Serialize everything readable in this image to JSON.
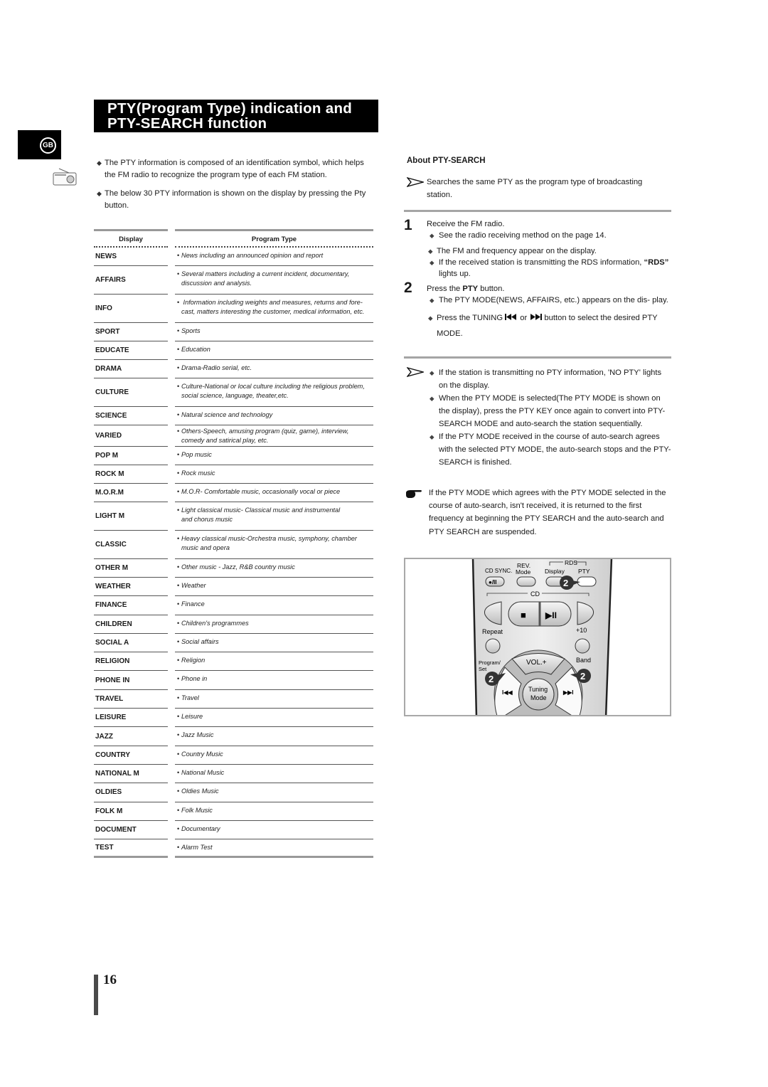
{
  "header": {
    "title_line1": "PTY(Program Type) indication and",
    "title_line2": "PTY-SEARCH function",
    "language_badge": "GB",
    "section_icon": "radio-icon"
  },
  "intro": [
    {
      "line1": "The PTY information is composed of an identification symbol, which helps",
      "line2": "the FM radio to recognize the program type of each FM station."
    },
    {
      "line1": "The below 30 PTY information is shown on the display by pressing the Pty",
      "line2": "button."
    }
  ],
  "bullet_diamond": "◆",
  "pty_table": {
    "headers": {
      "display": "Display",
      "program_type": "Program Type"
    },
    "rows": [
      {
        "display": "NEWS",
        "l1": "News including an announced opinion and report",
        "l2": ""
      },
      {
        "display": "AFFAIRS",
        "l1": "Several matters including a current incident, documentary,",
        "l2": "discussion and analysis."
      },
      {
        "display": "INFO",
        "l1": " Information including weights and measures, returns and fore-",
        "l2": "cast, matters interesting the customer, medical information, etc."
      },
      {
        "display": "SPORT",
        "l1": "Sports",
        "l2": ""
      },
      {
        "display": "EDUCATE",
        "l1": "Education",
        "l2": ""
      },
      {
        "display": "DRAMA",
        "l1": "Drama-Radio serial, etc.",
        "l2": ""
      },
      {
        "display": "CULTURE",
        "l1": "Culture-National or local culture including the religious problem,",
        "l2": "social science, language, theater,etc."
      },
      {
        "display": "SCIENCE",
        "l1": "Natural science and technology",
        "l2": ""
      },
      {
        "display": "VARIED",
        "l1": "Others-Speech, amusing program (quiz, game), interview,",
        "l2": "comedy and satirical play, etc."
      },
      {
        "display": "POP M",
        "l1": "Pop music",
        "l2": ""
      },
      {
        "display": "ROCK M",
        "l1": "Rock music",
        "l2": ""
      },
      {
        "display": "M.O.R.M",
        "l1": "M.O.R- Comfortable music, occasionally vocal or piece",
        "l2": ""
      },
      {
        "display": "LIGHT M",
        "l1": "Light classical music- Classical music and instrumental",
        "l2": "and chorus music"
      },
      {
        "display": "CLASSIC",
        "l1": "Heavy classical  music-Orchestra music, symphony, chamber",
        "l2": "music and opera"
      },
      {
        "display": "OTHER M",
        "l1": "Other music - Jazz, R&B country music",
        "l2": ""
      },
      {
        "display": "WEATHER",
        "l1": "Weather",
        "l2": ""
      },
      {
        "display": "FINANCE",
        "l1": "Finance",
        "l2": ""
      },
      {
        "display": "CHILDREN",
        "l1": "Children's programmes",
        "l2": ""
      },
      {
        "display": "SOCIAL  A",
        "l1": "Social affairs",
        "l2": ""
      },
      {
        "display": "RELIGION",
        "l1": "Religion",
        "l2": ""
      },
      {
        "display": "PHONE IN",
        "l1": "Phone in",
        "l2": ""
      },
      {
        "display": "TRAVEL",
        "l1": "Travel",
        "l2": ""
      },
      {
        "display": "LEISURE",
        "l1": "Leisure",
        "l2": ""
      },
      {
        "display": "JAZZ",
        "l1": "Jazz Music",
        "l2": ""
      },
      {
        "display": "COUNTRY",
        "l1": "Country Music",
        "l2": ""
      },
      {
        "display": "NATIONAL M",
        "l1": "National Music",
        "l2": ""
      },
      {
        "display": "OLDIES",
        "l1": "Oldies Music",
        "l2": ""
      },
      {
        "display": "FOLK M",
        "l1": "Folk Music",
        "l2": ""
      },
      {
        "display": "DOCUMENT",
        "l1": "Documentary",
        "l2": ""
      },
      {
        "display": "TEST",
        "l1": "Alarm Test",
        "l2": ""
      }
    ]
  },
  "about": {
    "heading": "About PTY-SEARCH",
    "note": "Searches the same PTY as the program type of broadcasting station."
  },
  "steps": [
    {
      "number": "1",
      "text": "Receive the FM radio.",
      "bullets": [
        "See the radio receiving method on the page 14.",
        "The FM and frequency appear on the display.",
        "If the received station is transmitting the RDS information, "
      ],
      "rds_quote": "“RDS”",
      "rds_tail": " lights up."
    },
    {
      "number": "2",
      "text_pre": "Press the ",
      "text_bold": "PTY",
      "text_post": " button.",
      "bullets": [
        "The PTY MODE(NEWS, AFFAIRS, etc.) appears on the dis- play."
      ],
      "tuning_pre": "Press the TUNING ",
      "tuning_or": " or ",
      "tuning_post": " button to select the desired PTY MODE."
    }
  ],
  "notes": [
    "If the station is transmitting no PTY information, 'NO PTY' lights on the display.",
    "When the PTY MODE is selected(The PTY MODE is shown on the display), press the PTY KEY once again to convert into PTY-SEARCH MODE and auto-search the station sequentially.",
    "If the PTY MODE received in the course of auto-search agrees with the selected PTY MODE, the auto-search stops and the PTY-SEARCH is finished."
  ],
  "tip": "If the PTY MODE which agrees with the PTY MODE selected in the course of auto-search, isn't received, it is returned to the first frequency at beginning the PTY SEARCH and the auto-search and PTY SEARCH are suspended.",
  "remote": {
    "labels": {
      "cd_sync": "CD SYNC.",
      "rev": "REV.",
      "mode": "Mode",
      "rds": "RDS",
      "display": "Display",
      "pty": "PTY",
      "rec_pause": "●/II",
      "cd": "CD",
      "stop": "■",
      "play_pause": "▶II",
      "repeat": "Repeat",
      "plus10": "+10",
      "program": "Program/",
      "set": "Set",
      "vol_plus": "VOL.+",
      "band": "Band",
      "tuning": "Tuning",
      "tuning_mode": "Mode",
      "prev": "I◀◀",
      "next": "▶▶I",
      "callout": "2"
    }
  },
  "footer": {
    "page_number": "16"
  }
}
